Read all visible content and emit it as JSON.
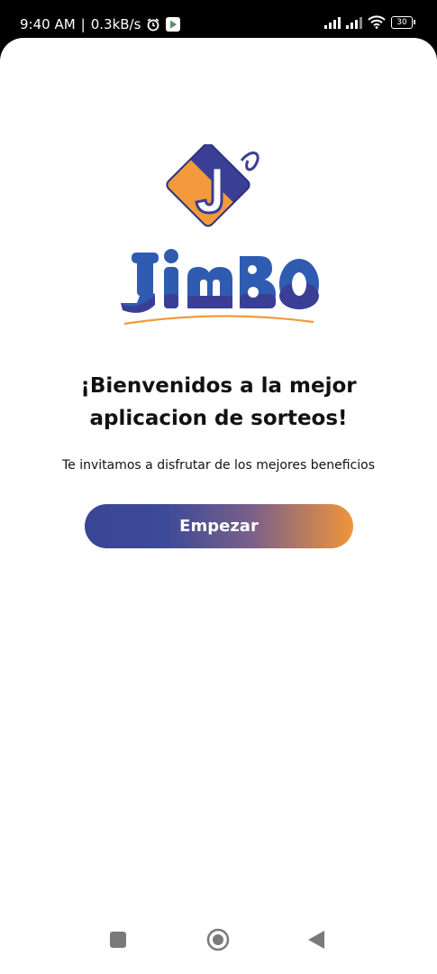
{
  "status_bar": {
    "time": "9:40 AM",
    "separator": "|",
    "speed": "0.3kB/s",
    "battery_level": "30",
    "icons": [
      "alarm-icon",
      "play-store-icon",
      "signal-icon",
      "signal-icon",
      "wifi-icon",
      "battery-icon"
    ]
  },
  "logo": {
    "name": "Jimbo",
    "colors": {
      "purple": "#3a3f95",
      "orange": "#f39a3c",
      "blue": "#2f5bb0"
    }
  },
  "welcome": {
    "line1": "¡Bienvenidos a la mejor",
    "line2": "aplicacion de sorteos!"
  },
  "subtitle": "Te invitamos a disfrutar de los mejores beneficios",
  "start_button": {
    "label": "Empezar",
    "gradient": [
      "#3a4596",
      "#f0953a"
    ]
  },
  "nav_bar": {
    "buttons": [
      "recents-square-icon",
      "home-circle-icon",
      "back-triangle-icon"
    ]
  }
}
